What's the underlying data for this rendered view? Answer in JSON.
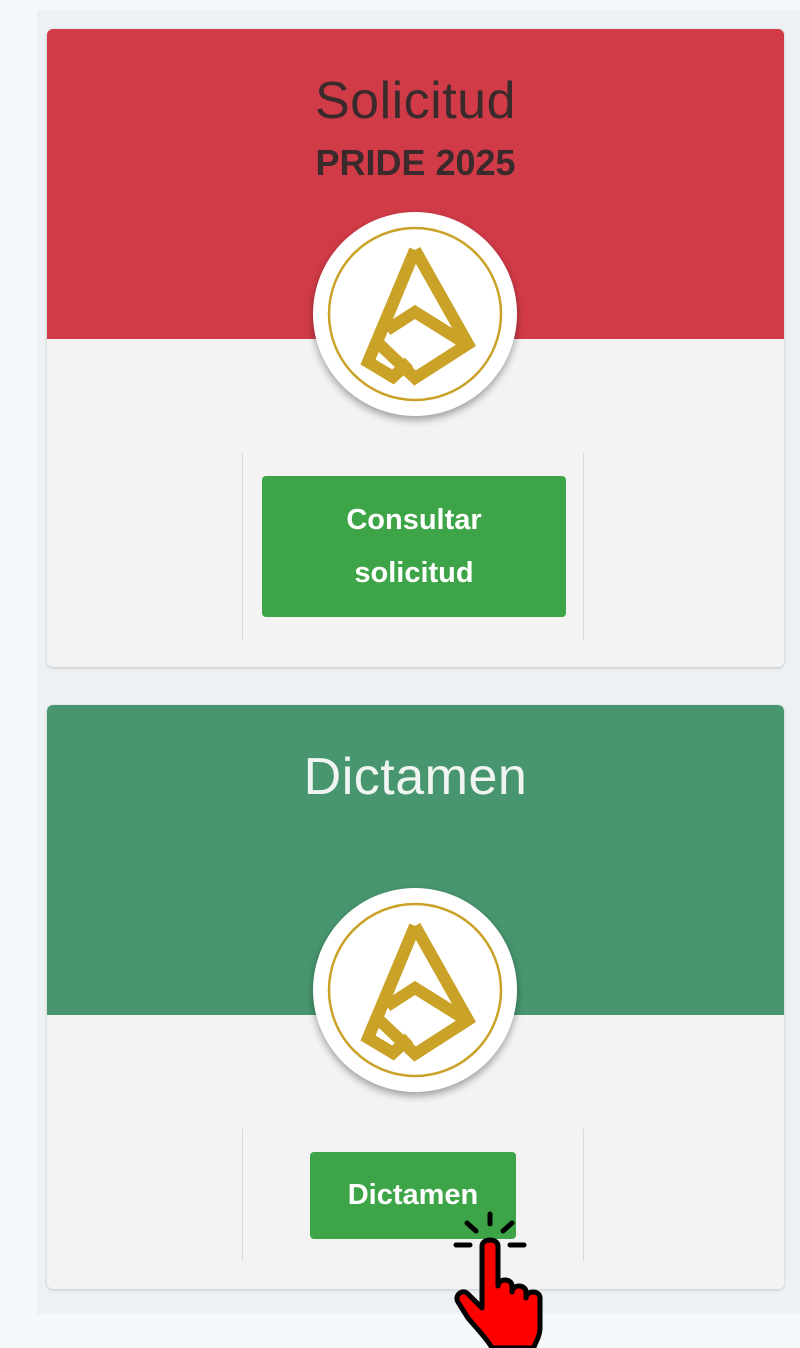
{
  "cards": [
    {
      "title": "Solicitud",
      "subtitle": "PRIDE 2025",
      "header_color": "#d03b47",
      "button_label_line1": "Consultar",
      "button_label_line2": "solicitud",
      "logo_icon": "gold-triangle-logo-icon"
    },
    {
      "title": "Dictamen",
      "header_color": "#48966f",
      "button_label": "Dictamen",
      "logo_icon": "gold-triangle-logo-icon"
    }
  ],
  "colors": {
    "button_green": "#3da547",
    "card_background": "#f3f3f4",
    "logo_gold": "#c9a227"
  },
  "cursor_icon": "hand-pointer-cursor-icon"
}
